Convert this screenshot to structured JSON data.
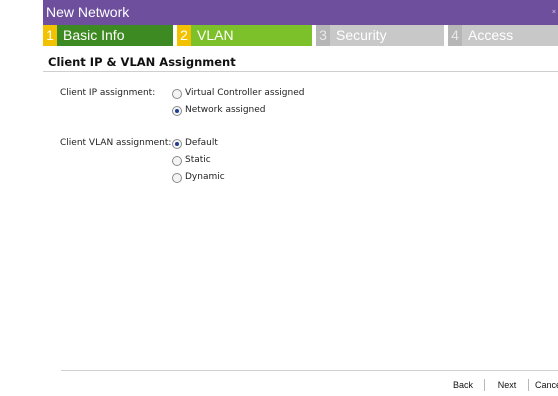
{
  "dialog": {
    "title": "New Network",
    "close_label": "×"
  },
  "steps": [
    {
      "number": "1",
      "label": "Basic Info",
      "state": "completed"
    },
    {
      "number": "2",
      "label": "VLAN",
      "state": "active"
    },
    {
      "number": "3",
      "label": "Security",
      "state": "pending"
    },
    {
      "number": "4",
      "label": "Access",
      "state": "pending"
    }
  ],
  "section": {
    "title": "Client IP & VLAN Assignment"
  },
  "ip_assignment": {
    "label": "Client IP assignment:",
    "options": [
      {
        "label": "Virtual Controller assigned",
        "selected": false
      },
      {
        "label": "Network assigned",
        "selected": true
      }
    ]
  },
  "vlan_assignment": {
    "label": "Client VLAN assignment:",
    "options": [
      {
        "label": "Default",
        "selected": true
      },
      {
        "label": "Static",
        "selected": false
      },
      {
        "label": "Dynamic",
        "selected": false
      }
    ]
  },
  "footer": {
    "back_label": "Back",
    "next_label": "Next",
    "cancel_label": "Cance"
  },
  "colors": {
    "titlebar": "#6d4f9d",
    "step_completed": "#3d8a22",
    "step_active": "#7cc02a",
    "step_pending": "#c8c8c8",
    "step_number_active": "#f2c200"
  }
}
